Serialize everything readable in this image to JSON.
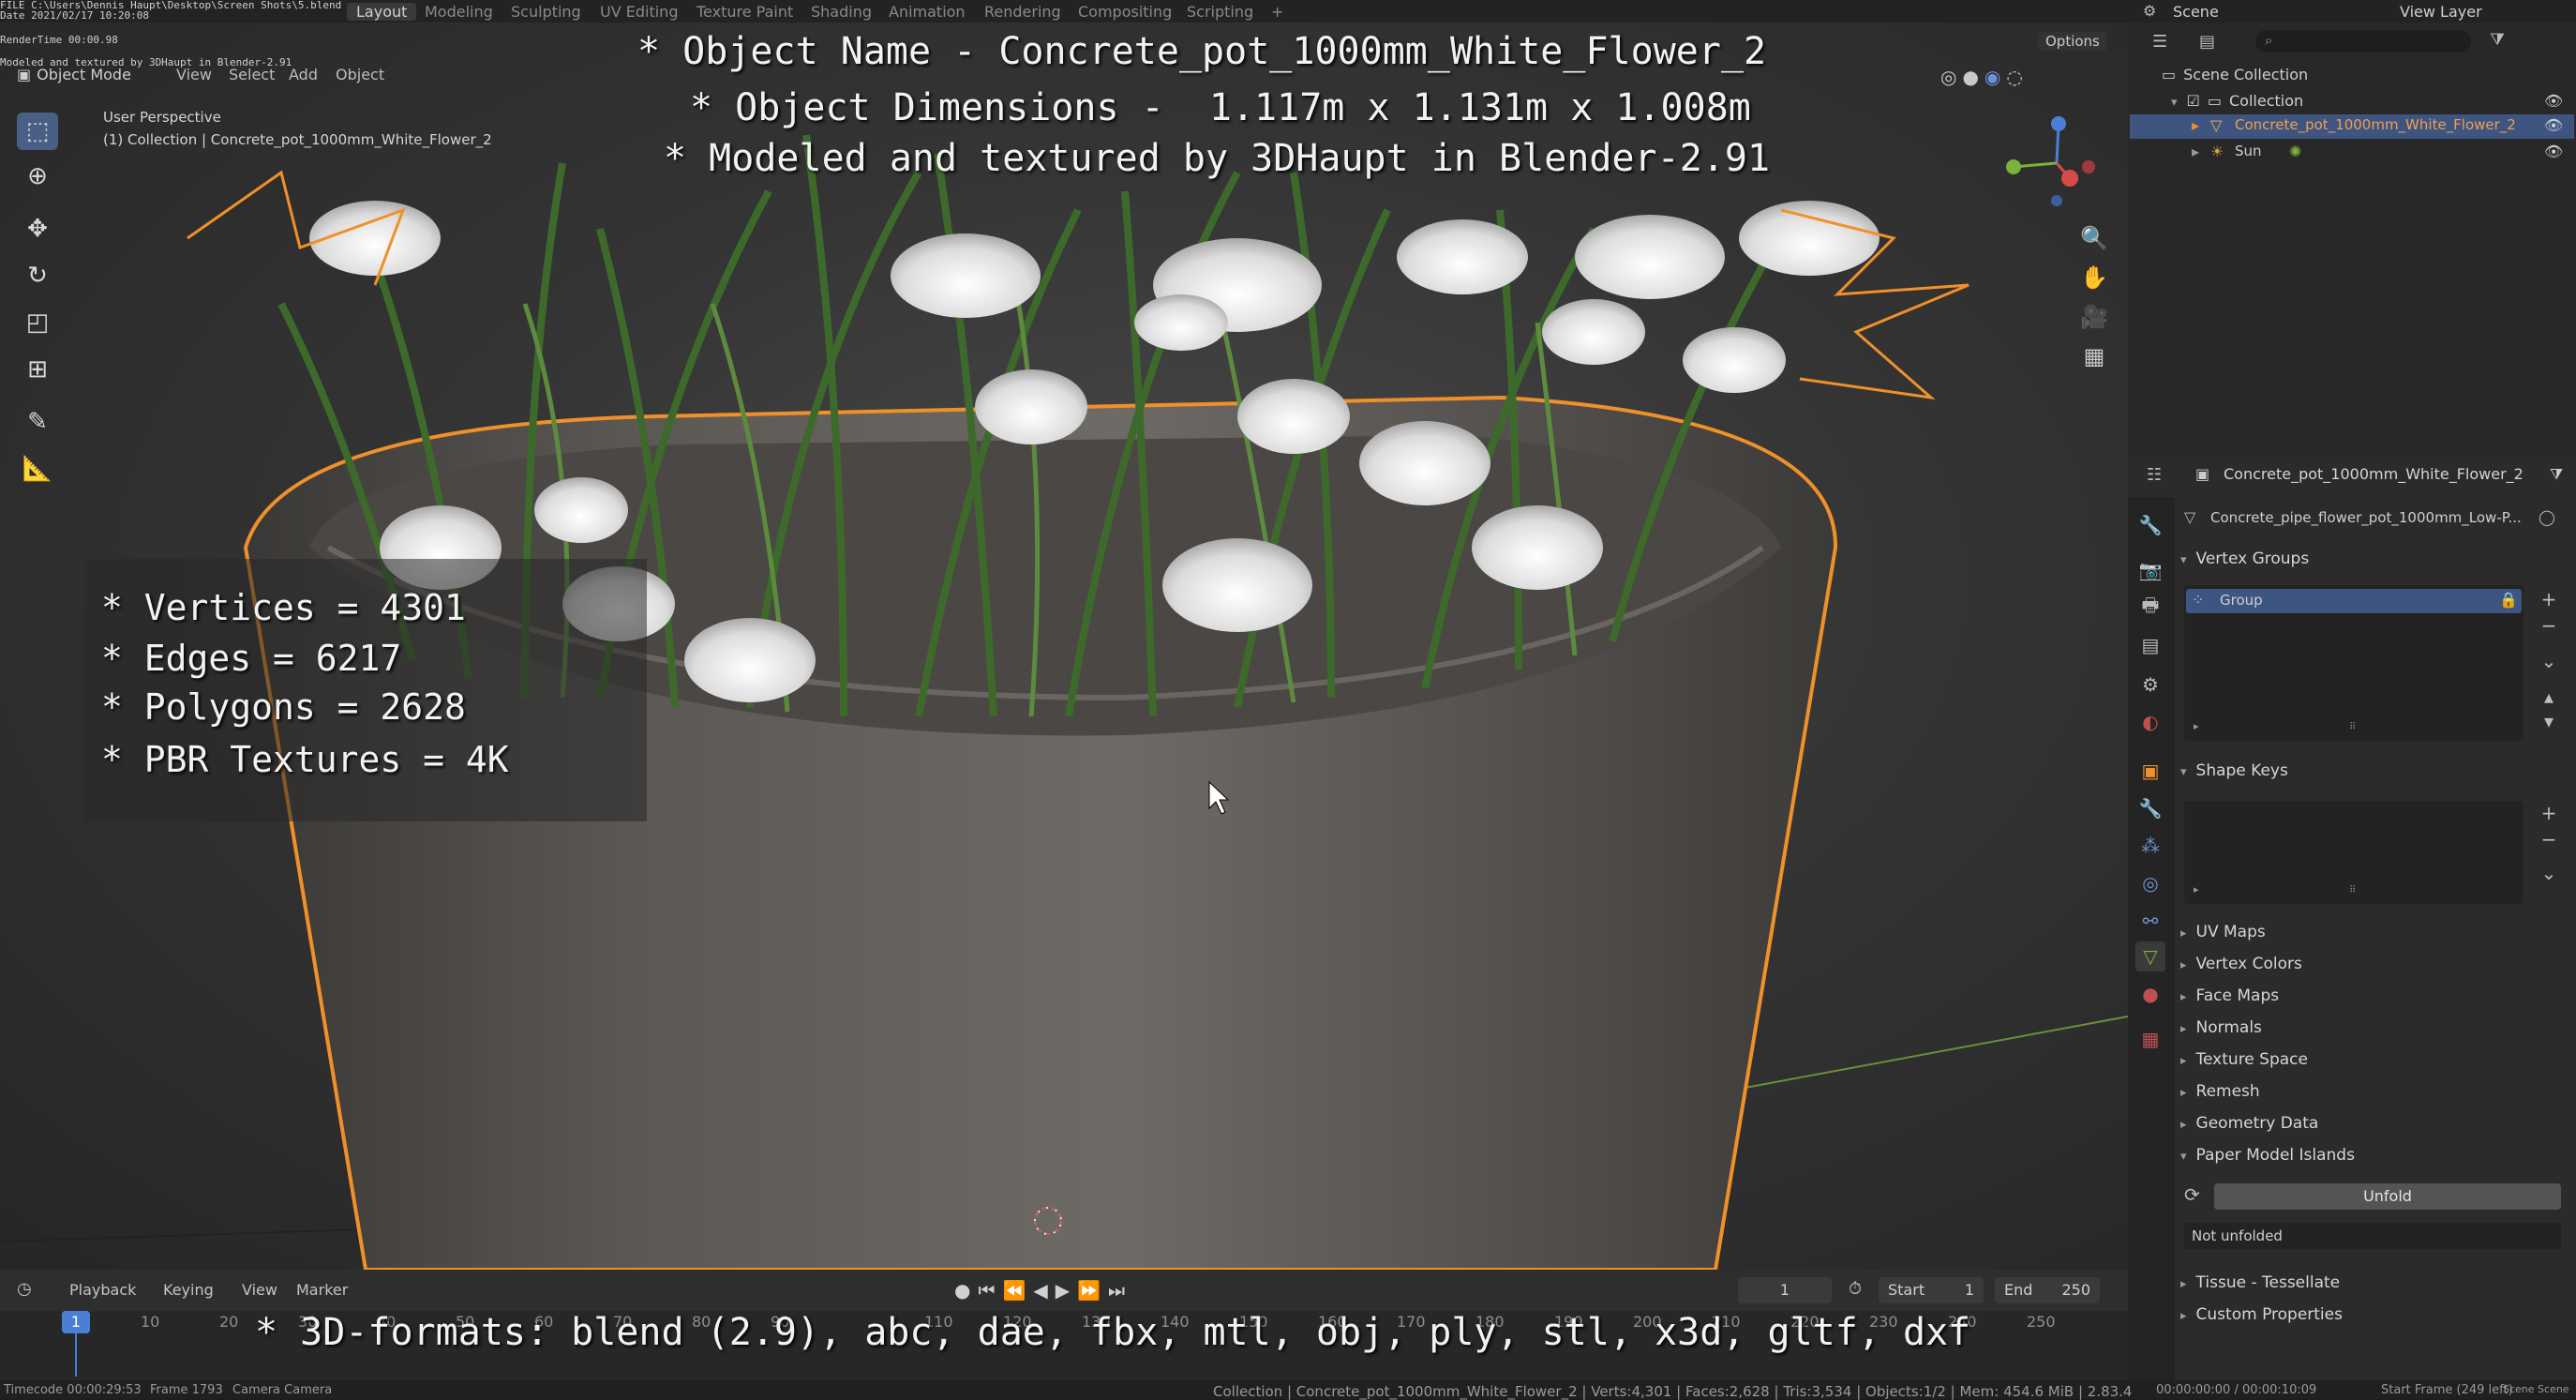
{
  "app": {
    "file_path": "FILE C:\\Users\\Dennis Haupt\\Desktop\\Screen Shots\\5.blend",
    "date": "Date 2021/02/17 10:20:08",
    "render_time": "RenderTime 00:00.98",
    "credit_small": "Modeled and textured by 3DHaupt in Blender-2.91"
  },
  "workspace_tabs": [
    "Layout",
    "Modeling",
    "Sculpting",
    "UV Editing",
    "Texture Paint",
    "Shading",
    "Animation",
    "Rendering",
    "Compositing",
    "Scripting"
  ],
  "add_tab": "+",
  "top_right": {
    "scene": "Scene",
    "view_layer": "View Layer"
  },
  "viewport": {
    "mode": "Object Mode",
    "menus": [
      "View",
      "Select",
      "Add",
      "Object"
    ],
    "options": "Options",
    "perspective": "User Perspective",
    "collection_path": "(1) Collection | Concrete_pot_1000mm_White_Flower_2",
    "overlay_lines": [
      "* Object Name - Concrete_pot_1000mm_White_Flower_2",
      "* Object Dimensions -  1.117m x 1.131m x 1.008m",
      "* Modeled and textured by 3DHaupt in Blender-2.91"
    ],
    "stats_lines": [
      "* Vertices = 4301",
      "* Edges = 6217",
      "* Polygons = 2628",
      "* PBR Textures = 4K"
    ],
    "formats_line": "* 3D-formats: blend (2.9), abc, dae, fbx, mtl, obj, ply, stl, x3d, gltf, dxf",
    "tools": [
      "select-box-icon",
      "cursor-icon",
      "move-icon",
      "rotate-icon",
      "scale-icon",
      "transform-icon",
      "annotate-icon",
      "measure-icon"
    ],
    "nav": [
      "zoom-icon",
      "hand-icon",
      "camera-icon",
      "grid-icon"
    ]
  },
  "outliner": {
    "scene_collection": "Scene Collection",
    "collection": "Collection",
    "items": [
      {
        "label": "Concrete_pot_1000mm_White_Flower_2",
        "selected": true
      },
      {
        "label": "Sun",
        "selected": false
      }
    ]
  },
  "properties": {
    "object_name": "Concrete_pot_1000mm_White_Flower_2",
    "mesh_name": "Concrete_pipe_flower_pot_1000mm_Low-P...",
    "vertex_groups_title": "Vertex Groups",
    "vertex_group_item": "Group",
    "shape_keys_title": "Shape Keys",
    "collapsed_panels": [
      "UV Maps",
      "Vertex Colors",
      "Face Maps",
      "Normals",
      "Texture Space",
      "Remesh",
      "Geometry Data"
    ],
    "paper_model_title": "Paper Model Islands",
    "unfold_button": "Unfold",
    "unfold_status": "Not unfolded",
    "tail_panels": [
      "Tissue - Tessellate",
      "Custom Properties"
    ]
  },
  "timeline": {
    "menus": [
      "Playback",
      "Keying",
      "View",
      "Marker"
    ],
    "current_frame": "1",
    "start_label": "Start",
    "start_value": "1",
    "end_label": "End",
    "end_value": "250",
    "ticks": [
      "1",
      "10",
      "20",
      "30",
      "40",
      "50",
      "60",
      "70",
      "80",
      "90",
      "110",
      "120",
      "130",
      "140",
      "150",
      "160",
      "170",
      "180",
      "190",
      "200",
      "210",
      "220",
      "230",
      "240",
      "250"
    ]
  },
  "statusbar": {
    "timecode": "Timecode 00:00:29:53",
    "frame": "Frame 1793",
    "camera": "Camera Camera",
    "stats": "Collection | Concrete_pot_1000mm_White_Flower_2 | Verts:4,301 | Faces:2,628 | Tris:3,534 | Objects:1/2 | Mem: 454.6 MiB | 2.83.4",
    "time": "00:00:00:00 / 00:00:10:09",
    "start_frame": "Start Frame (249 left)",
    "scene": "Scene Scene"
  },
  "colors": {
    "accent": "#4a5f86",
    "selection": "#f0902a",
    "header": "#232323"
  }
}
